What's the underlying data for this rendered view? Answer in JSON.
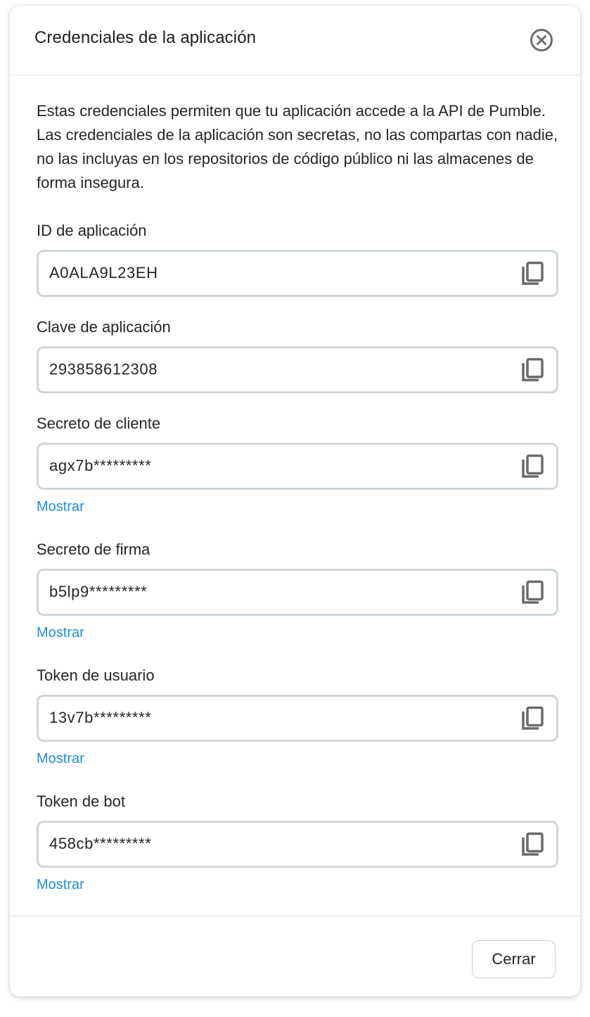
{
  "dialog": {
    "title": "Credenciales de la aplicación",
    "description": "Estas credenciales permiten que tu aplicación accede a la API de Pumble. Las credenciales de la aplicación son secretas, no las compartas con nadie, no las incluyas en los repositorios de código público ni las almacenes de forma insegura.",
    "close_icon": "close-circle-icon",
    "copy_icon": "copy-icon"
  },
  "fields": [
    {
      "label": "ID de aplicación",
      "value": "A0ALA9L23EH"
    },
    {
      "label": "Clave de aplicación",
      "value": "293858612308"
    },
    {
      "label": "Secreto de cliente",
      "value": "agx7b*********",
      "show_label": "Mostrar"
    },
    {
      "label": "Secreto de firma",
      "value": "b5lp9*********",
      "show_label": "Mostrar"
    },
    {
      "label": "Token de usuario",
      "value": "13v7b*********",
      "show_label": "Mostrar"
    },
    {
      "label": "Token de bot",
      "value": "458cb*********",
      "show_label": "Mostrar"
    }
  ],
  "footer": {
    "close_label": "Cerrar"
  },
  "colors": {
    "link": "#1f8fd6",
    "border": "#cfd6da",
    "icon": "#6b6b6b"
  }
}
